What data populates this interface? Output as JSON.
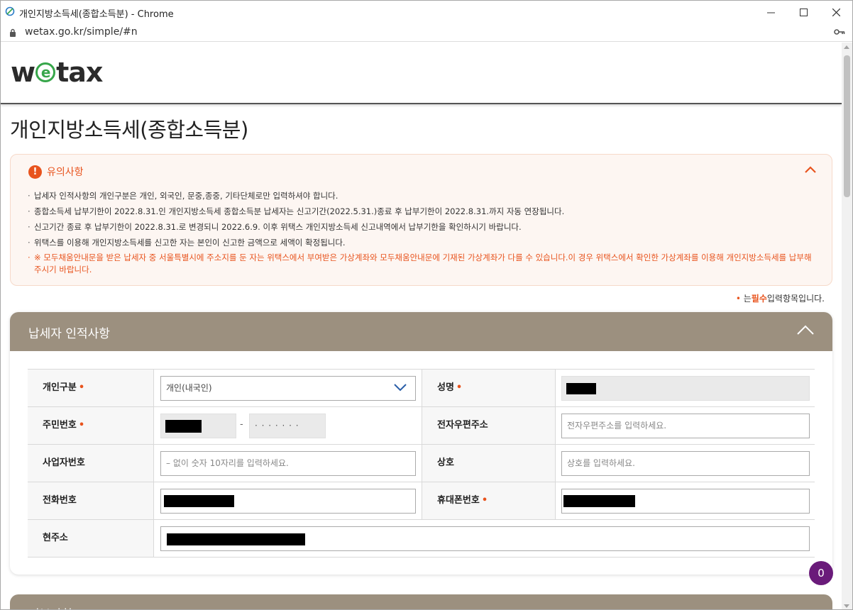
{
  "window": {
    "title": "개인지방소득세(종합소득분) - Chrome",
    "url": "wetax.go.kr/simple/#n"
  },
  "header": {
    "logo": {
      "w": "w",
      "e": "e",
      "tax": "tax"
    }
  },
  "page_title": "개인지방소득세(종합소득분)",
  "notice": {
    "heading": "유의사항",
    "items": [
      "납세자 인적사항의 개인구분은 개인, 외국인, 문중,종중, 기타단체로만 입력하셔야 합니다.",
      "종합소득세 납부기한이 2022.8.31.인 개인지방소득세 종합소득분 납세자는 신고기간(2022.5.31.)종료 후 납부기한이 2022.8.31.까지 자동 연장됩니다.",
      "신고기간 종료 후 납부기한이 2022.8.31.로 변경되니 2022.6.9. 이후 위택스 개인지방소득세 신고내역에서 납부기한을 확인하시기 바랍니다.",
      "위택스를 이용해 개인지방소득세를 신고한 자는 본인이 신고한 금액으로 세액이 확정됩니다."
    ],
    "warning": "※ 모두채움안내문을 받은 납세자 중 서울특별시에 주소지를 둔 자는 위택스에서 부여받은 가상계좌와 모두채움안내문에 기재된 가상계좌가 다를 수 있습니다.이 경우 위택스에서 확인한 가상계좌를 이용해 개인지방소득세를 납부해 주시기 바랍니다."
  },
  "required_note": {
    "dot": "•",
    "pre": "는",
    "bold": "필수",
    "post": "입력항목입니다."
  },
  "section": {
    "title": "납세자 인적사항",
    "fields": {
      "type_label": "개인구분",
      "type_value": "개인(내국인)",
      "name_label": "성명",
      "rrn_label": "주민번호",
      "rrn_dash": "-",
      "rrn_mask": "· · · · · · ·",
      "email_label": "전자우편주소",
      "email_placeholder": "전자우편주소를 입력하세요.",
      "biz_label": "사업자번호",
      "biz_placeholder": "– 없이 숫자 10자리를 입력하세요.",
      "company_label": "상호",
      "company_placeholder": "상호를 입력하세요.",
      "phone_label": "전화번호",
      "mobile_label": "휴대폰번호",
      "address_label": "현주소",
      "req_mark": "•"
    }
  },
  "next_section": {
    "title": "기본사항"
  },
  "chat_badge": {
    "count": "0"
  },
  "colors": {
    "accent": "#e8531d",
    "section_header": "#9c907f",
    "logo_green": "#37a64a",
    "badge": "#6a1b7a"
  }
}
